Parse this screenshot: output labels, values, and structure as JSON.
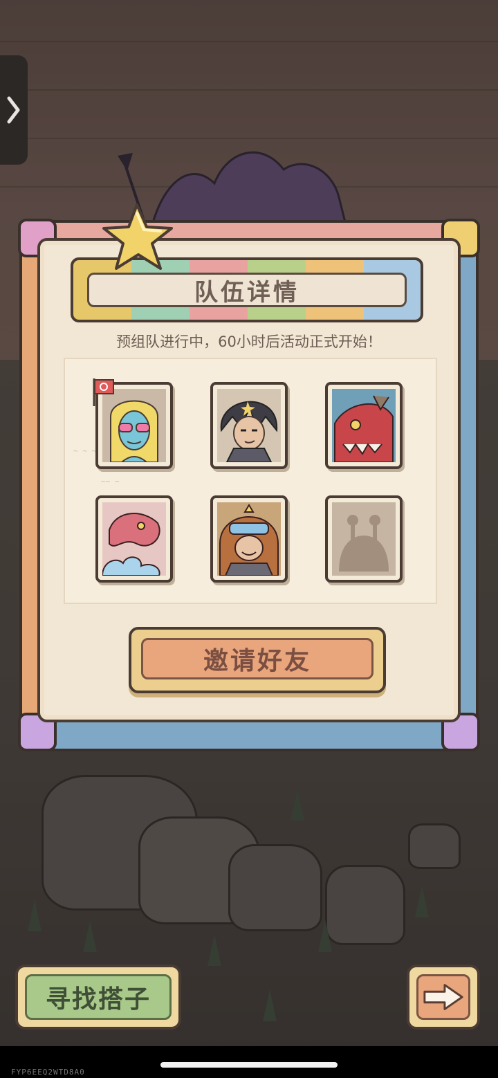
{
  "modal": {
    "title": "队伍详情",
    "subtitle": "预组队进行中，60小时后活动正式开始！",
    "invite_label": "邀请好友"
  },
  "team": {
    "slots": [
      {
        "state": "filled",
        "portrait": "blonde-sunglasses-hero",
        "leader": true
      },
      {
        "state": "filled",
        "portrait": "dark-hair-warrior"
      },
      {
        "state": "filled",
        "portrait": "red-dragon-beast"
      },
      {
        "state": "filled",
        "portrait": "pink-dragon-cloud"
      },
      {
        "state": "filled",
        "portrait": "monkey-king-goggles"
      },
      {
        "state": "empty",
        "portrait": "silhouette-placeholder"
      }
    ]
  },
  "buttons": {
    "find_partner": "寻找搭子",
    "next_icon": "right-arrow-icon"
  },
  "side_tab_icon": "chevron-right-icon",
  "watermark": "FYP6EEQ2WTD8A0",
  "colors": {
    "panel": "#f2e7d4",
    "invite": "#e9a57c",
    "find": "#a9c98b"
  }
}
